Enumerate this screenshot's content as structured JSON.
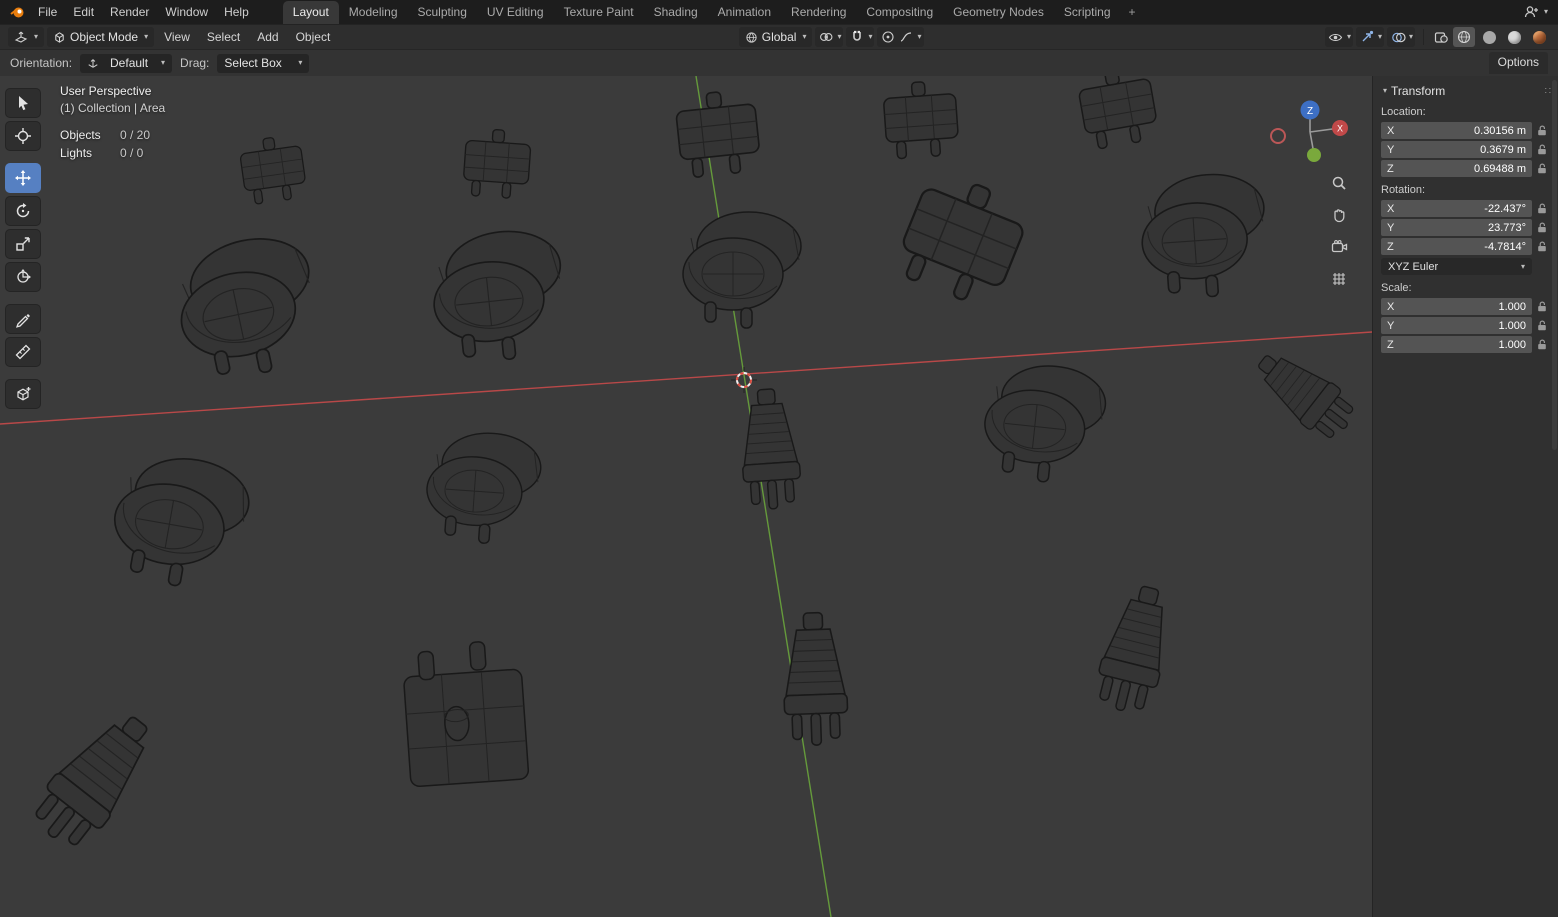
{
  "colors": {
    "accent": "#5680c2",
    "axis_x": "#cf4b4b",
    "axis_y": "#6dab3c",
    "gizmo_z": "#3d6fc4"
  },
  "icons": {
    "chevron_down": "▾",
    "grip": "∷"
  },
  "topbar": {
    "menus": [
      "File",
      "Edit",
      "Render",
      "Window",
      "Help"
    ],
    "tabs": [
      "Layout",
      "Modeling",
      "Sculpting",
      "UV Editing",
      "Texture Paint",
      "Shading",
      "Animation",
      "Rendering",
      "Compositing",
      "Geometry Nodes",
      "Scripting"
    ],
    "active_tab": "Layout",
    "add_tab": "+"
  },
  "header": {
    "mode": "Object Mode",
    "menus": [
      "View",
      "Select",
      "Add",
      "Object"
    ],
    "orientation": "Global"
  },
  "tool_settings": {
    "orientation_label": "Orientation:",
    "orientation_value": "Default",
    "drag_label": "Drag:",
    "drag_value": "Select Box",
    "options_label": "Options"
  },
  "viewport": {
    "title": "User Perspective",
    "context": "(1) Collection | Area",
    "stats": [
      {
        "label": "Objects",
        "value": "0 / 20"
      },
      {
        "label": "Lights",
        "value": "0 / 0"
      }
    ],
    "gizmo": {
      "z": "Z",
      "x": "X"
    }
  },
  "npanel": {
    "title": "Transform",
    "location_label": "Location:",
    "location": [
      {
        "axis": "X",
        "value": "0.30156 m"
      },
      {
        "axis": "Y",
        "value": "0.3679 m"
      },
      {
        "axis": "Z",
        "value": "0.69488 m"
      }
    ],
    "rotation_label": "Rotation:",
    "rotation": [
      {
        "axis": "X",
        "value": "-22.437°"
      },
      {
        "axis": "Y",
        "value": "23.773°"
      },
      {
        "axis": "Z",
        "value": "-4.7814°"
      }
    ],
    "euler_mode": "XYZ Euler",
    "scale_label": "Scale:",
    "scale": [
      {
        "axis": "X",
        "value": "1.000"
      },
      {
        "axis": "Y",
        "value": "1.000"
      },
      {
        "axis": "Z",
        "value": "1.000"
      }
    ]
  }
}
